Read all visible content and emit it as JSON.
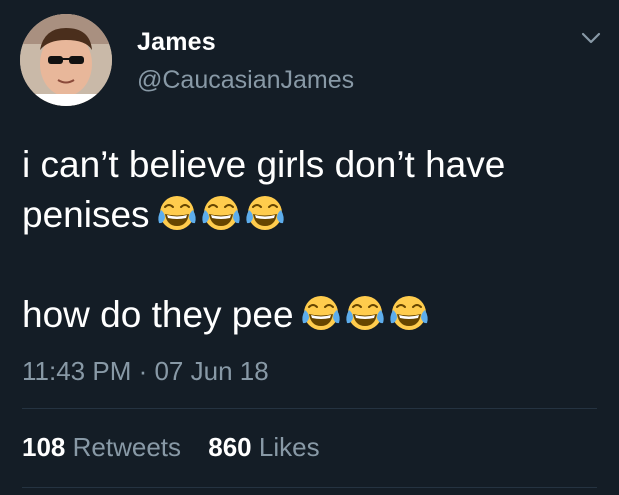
{
  "user": {
    "display_name": "James",
    "handle": "@CaucasianJames"
  },
  "tweet": {
    "line1_text": "i can’t believe girls don’t have penises",
    "line1_emoji": [
      "face-with-tears-of-joy",
      "face-with-tears-of-joy",
      "face-with-tears-of-joy"
    ],
    "line2_text": "how do they pee",
    "line2_emoji": [
      "face-with-tears-of-joy",
      "face-with-tears-of-joy",
      "face-with-tears-of-joy"
    ],
    "timestamp": "11:43 PM · 07 Jun 18"
  },
  "stats": {
    "retweets_count": "108",
    "retweets_label": "Retweets",
    "likes_count": "860",
    "likes_label": "Likes"
  },
  "colors": {
    "background": "#141d26",
    "text_primary": "#ffffff",
    "text_secondary": "#8899a6",
    "divider": "#253341"
  },
  "icons": {
    "menu": "chevron-down-icon"
  }
}
